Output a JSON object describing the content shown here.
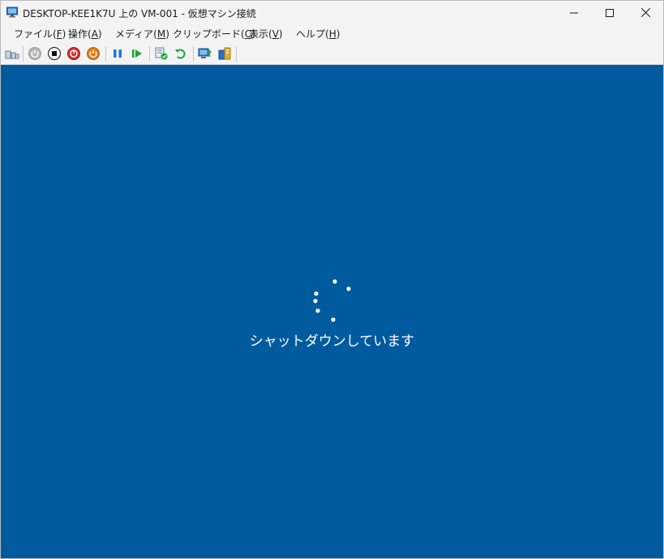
{
  "window": {
    "title": "DESKTOP-KEE1K7U 上の VM-001 - 仮想マシン接続",
    "app_icon": "monitor-icon",
    "controls": {
      "minimize_icon": "minimize-icon",
      "maximize_icon": "maximize-icon",
      "close_icon": "close-icon"
    }
  },
  "menu": {
    "file": {
      "label": "ファイル(",
      "mnemonic": "F",
      "end": ")"
    },
    "action": {
      "label": "操作(",
      "mnemonic": "A",
      "end": ")"
    },
    "media": {
      "label": "メディア(",
      "mnemonic": "M",
      "end": ")"
    },
    "clipboard": {
      "label": "クリップボード(",
      "mnemonic": "C",
      "end": ")"
    },
    "view": {
      "label": "表示(",
      "mnemonic": "V",
      "end": ")"
    },
    "help": {
      "label": "ヘルプ(",
      "mnemonic": "H",
      "end": ")"
    }
  },
  "toolbar": {
    "icons": [
      "ctrl-alt-del-icon",
      "start-icon",
      "turn-off-icon",
      "shut-down-icon",
      "save-icon",
      "pause-icon",
      "resume-icon",
      "checkpoint-icon",
      "revert-icon",
      "enhanced-session-icon",
      "share-icon"
    ]
  },
  "screen": {
    "status_text": "シャットダウンしています",
    "background_color": "#005a9e",
    "spinner_icon": "loading-spinner-icon"
  },
  "colors": {
    "titlebar_bg": "#f3f3f3",
    "vm_screen": "#005a9e",
    "turn_off_red": "#d42a2a",
    "shut_down_orange": "#e07b12",
    "pause_blue": "#1e7ad6",
    "resume_green": "#1ea53a"
  }
}
